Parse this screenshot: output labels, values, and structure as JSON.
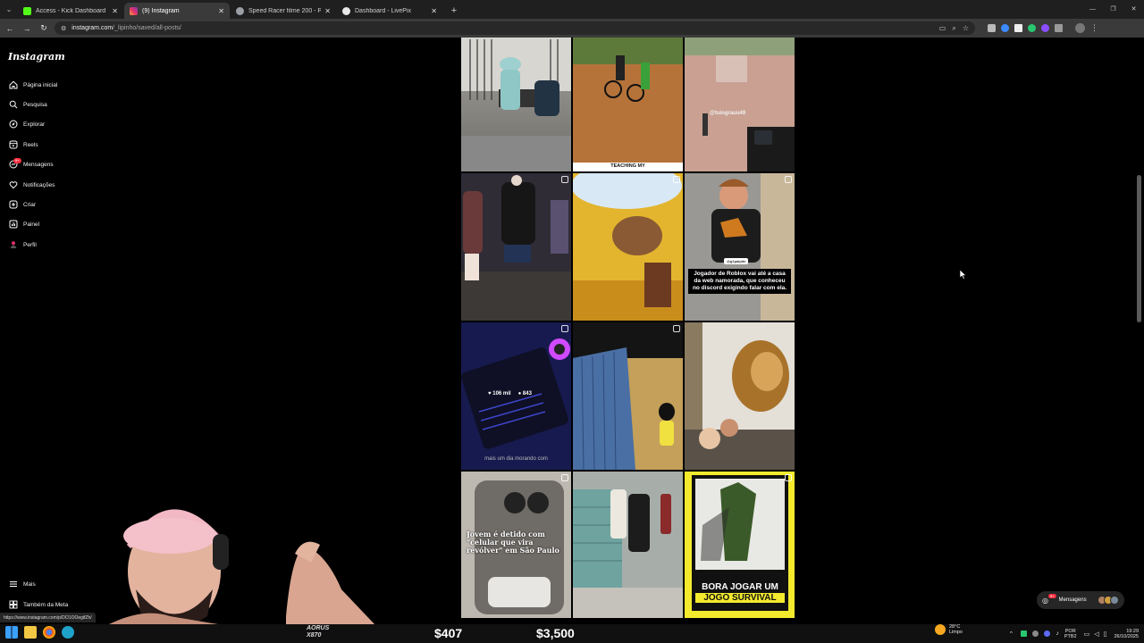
{
  "browser": {
    "tabs": [
      {
        "title": "Access - Kick Dashboard",
        "fav_color": "#53fc18",
        "active": false
      },
      {
        "title": "(9) Instagram",
        "fav_color": "#e1306c",
        "active": true
      },
      {
        "title": "Speed Racer filme 200 - Pesquisa",
        "fav_color": "#9aa0a6",
        "active": false
      },
      {
        "title": "Dashboard - LivePix",
        "fav_color": "#e8e8e8",
        "active": false
      }
    ],
    "url_host": "instagram.com",
    "url_path": "/_lipinho/saved/all-posts/"
  },
  "instagram": {
    "logo": "Instagram",
    "nav": [
      {
        "label": "Página inicial",
        "icon": "home-icon"
      },
      {
        "label": "Pesquisa",
        "icon": "search-icon"
      },
      {
        "label": "Explorar",
        "icon": "compass-icon"
      },
      {
        "label": "Reels",
        "icon": "reels-icon"
      },
      {
        "label": "Mensagens",
        "icon": "messenger-icon",
        "badge": "9+"
      },
      {
        "label": "Notificações",
        "icon": "heart-icon"
      },
      {
        "label": "Criar",
        "icon": "plus-square-icon"
      },
      {
        "label": "Painel",
        "icon": "dashboard-icon"
      },
      {
        "label": "Perfil",
        "icon": "profile-icon"
      }
    ],
    "more": "Mais",
    "meta": "Também da Meta",
    "messages_pill": {
      "label": "Mensagens",
      "badge": "9+"
    }
  },
  "posts": {
    "p3_handle": "@tuiograuu49",
    "p2_caption": "TEACHING MY",
    "p6_tag": "@g1palpite",
    "p6_caption": "Jogador de Roblox vai até a casa da web namorada, que conheceu no discord exigindo falar com ela.",
    "p7_likes": "106 mil",
    "p7_comments": "843",
    "p7_caption": "mais um dia morando com",
    "p10_caption": "Jovem é detido com \"celular que vira revólver\" em São Paulo",
    "p12_caption": "BORA JOGAR UM",
    "p12_caption_2": "JOGO SURVIVAL"
  },
  "stream": {
    "status_url": "https://www.instagram.com/p/DO1OOegifZh/",
    "aorus": "AORUS X870",
    "donation_1": "$407",
    "donation_2": "$3,500"
  },
  "taskbar": {
    "weather_temp": "28°C",
    "weather_desc": "Limpo",
    "lang_1": "POR",
    "lang_2": "PTB2",
    "time": "19:29",
    "date": "26/10/2025"
  }
}
